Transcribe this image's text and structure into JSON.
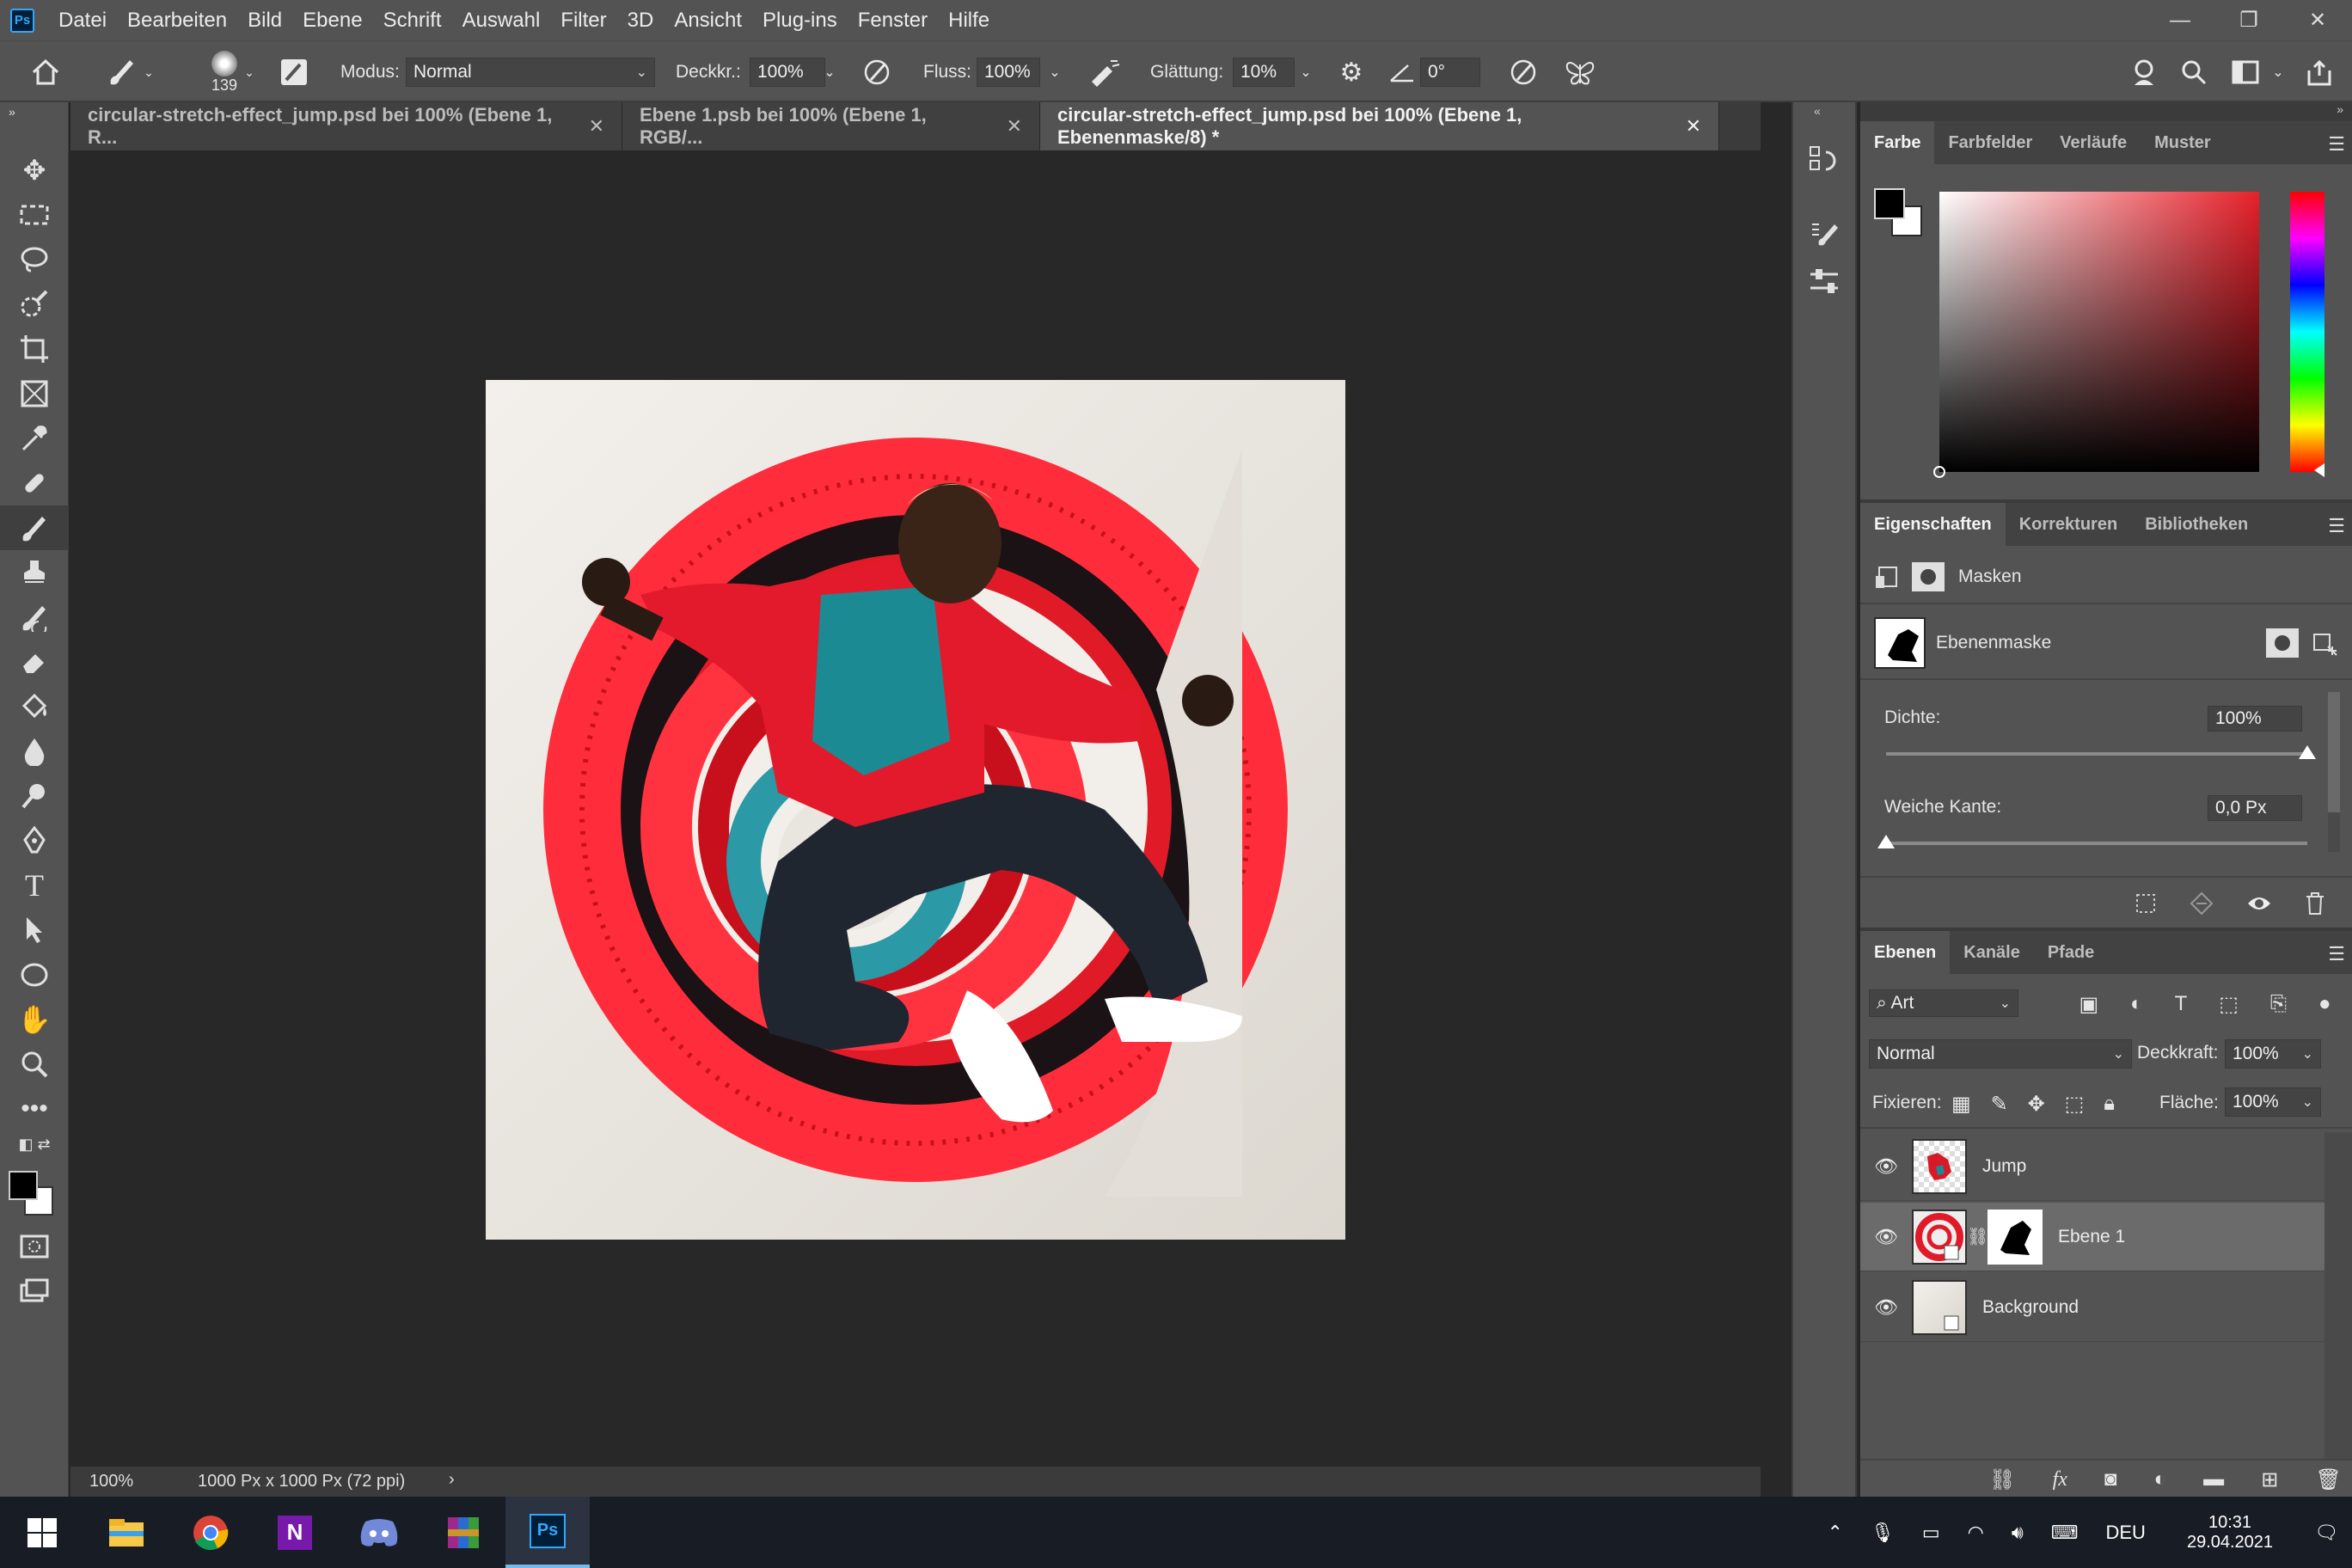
{
  "app": {
    "logo": "Ps"
  },
  "menu": [
    "Datei",
    "Bearbeiten",
    "Bild",
    "Ebene",
    "Schrift",
    "Auswahl",
    "Filter",
    "3D",
    "Ansicht",
    "Plug-ins",
    "Fenster",
    "Hilfe"
  ],
  "window_controls": {
    "minimize": "—",
    "restore": "❐",
    "close": "✕"
  },
  "options": {
    "brush_size": "139",
    "mode_label": "Modus:",
    "mode_value": "Normal",
    "opacity_label": "Deckkr.:",
    "opacity_value": "100%",
    "flow_label": "Fluss:",
    "flow_value": "100%",
    "smoothing_label": "Glättung:",
    "smoothing_value": "10%",
    "angle_value": "0°"
  },
  "tabs": [
    {
      "label": "circular-stretch-effect_jump.psd bei 100% (Ebene 1, R...",
      "close": "✕"
    },
    {
      "label": "Ebene 1.psb bei 100% (Ebene 1, RGB/...",
      "close": "✕"
    },
    {
      "label": "circular-stretch-effect_jump.psd bei 100% (Ebene 1, Ebenenmaske/8) *",
      "close": "✕"
    }
  ],
  "status": {
    "zoom": "100%",
    "doc_info": "1000 Px x 1000 Px (72 ppi)",
    "arrow": "›"
  },
  "color_panel": {
    "tabs": [
      "Farbe",
      "Farbfelder",
      "Verläufe",
      "Muster"
    ],
    "foreground": "#000000",
    "background": "#ffffff",
    "hue_color": "#e8202a"
  },
  "properties_panel": {
    "tabs": [
      "Eigenschaften",
      "Korrekturen",
      "Bibliotheken"
    ],
    "section": "Masken",
    "mask_label": "Ebenenmaske",
    "density_label": "Dichte:",
    "density_value": "100%",
    "feather_label": "Weiche Kante:",
    "feather_value": "0,0 Px",
    "density_level": 1.0,
    "feather_level": 0.0
  },
  "layers_panel": {
    "tabs": [
      "Ebenen",
      "Kanäle",
      "Pfade"
    ],
    "filter_label": "Art",
    "blend_mode": "Normal",
    "opacity_label": "Deckkraft:",
    "opacity_value": "100%",
    "lock_label": "Fixieren:",
    "fill_label": "Fläche:",
    "fill_value": "100%",
    "layers": [
      {
        "name": "Jump",
        "selected": false
      },
      {
        "name": "Ebene 1",
        "selected": true
      },
      {
        "name": "Background",
        "selected": false
      }
    ]
  },
  "taskbar": {
    "apps": [
      "windows-start",
      "file-explorer",
      "chrome",
      "onenote",
      "discord",
      "winrar",
      "photoshop"
    ],
    "active_app": "photoshop",
    "ps_label": "Ps",
    "onenote_label": "N",
    "language": "DEU",
    "time": "10:31",
    "date": "29.04.2021"
  }
}
